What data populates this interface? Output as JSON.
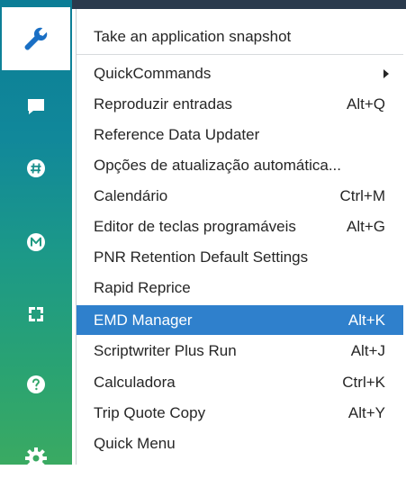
{
  "sidebar": {
    "buttons": [
      {
        "icon": "wrench-icon",
        "active": true
      },
      {
        "icon": "chat-icon"
      },
      {
        "icon": "hash-icon"
      },
      {
        "icon": "m-badge-icon",
        "glyph": "M"
      },
      {
        "icon": "refresh-icon"
      },
      {
        "icon": "help-icon",
        "glyph": "?"
      },
      {
        "icon": "gear-icon"
      }
    ]
  },
  "menu": {
    "items": [
      {
        "label": "Take an application snapshot",
        "shortcut": ""
      },
      {
        "label": "QuickCommands",
        "shortcut": "",
        "submenu": true
      },
      {
        "label": "Reproduzir entradas",
        "shortcut": "Alt+Q"
      },
      {
        "label": "Reference Data Updater",
        "shortcut": ""
      },
      {
        "label": "Opções de atualização automática...",
        "shortcut": ""
      },
      {
        "label": "Calendário",
        "shortcut": "Ctrl+M"
      },
      {
        "label": "Editor de teclas programáveis",
        "shortcut": "Alt+G"
      },
      {
        "label": "PNR Retention Default Settings",
        "shortcut": ""
      },
      {
        "label": "Rapid Reprice",
        "shortcut": ""
      },
      {
        "label": "EMD Manager",
        "shortcut": "Alt+K",
        "highlighted": true
      },
      {
        "label": "Scriptwriter Plus Run",
        "shortcut": "Alt+J"
      },
      {
        "label": "Calculadora",
        "shortcut": "Ctrl+K"
      },
      {
        "label": "Trip Quote Copy",
        "shortcut": "Alt+Y"
      },
      {
        "label": "Quick Menu",
        "shortcut": ""
      }
    ]
  },
  "colors": {
    "highlight": "#2f80cc",
    "sidebar_top": "#0b7d96",
    "sidebar_bottom": "#3aaa62"
  }
}
